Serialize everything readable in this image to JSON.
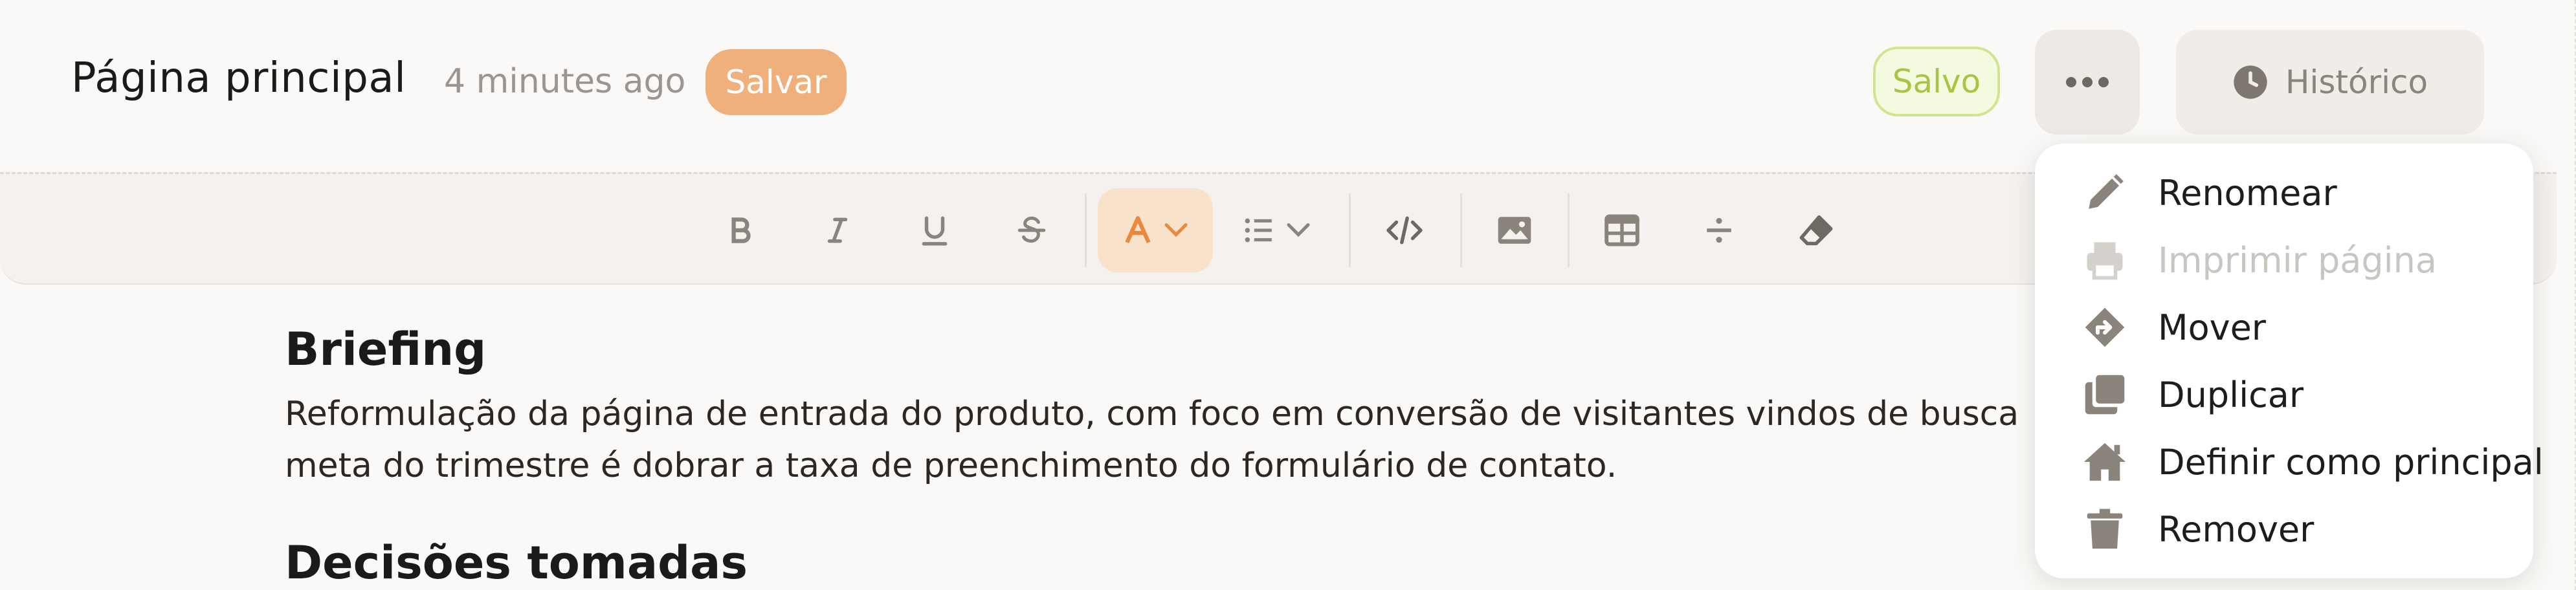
{
  "header": {
    "title": "Página principal",
    "timestamp": "4 minutes ago",
    "save_label": "Salvar",
    "saved_label": "Salvo",
    "more_icon": "more-horizontal-icon",
    "history_label": "Histórico",
    "history_icon": "clock-icon"
  },
  "toolbar": {
    "buttons": [
      {
        "name": "bold",
        "icon": "bold-icon"
      },
      {
        "name": "italic",
        "icon": "italic-icon"
      },
      {
        "name": "underline",
        "icon": "underline-icon"
      },
      {
        "name": "strikethrough",
        "icon": "strikethrough-icon"
      },
      {
        "name": "text-color",
        "icon": "text-color-icon",
        "active": true
      },
      {
        "name": "list",
        "icon": "list-icon"
      },
      {
        "name": "code",
        "icon": "code-icon"
      },
      {
        "name": "image",
        "icon": "image-icon"
      },
      {
        "name": "table",
        "icon": "table-icon"
      },
      {
        "name": "divider",
        "icon": "divide-icon"
      },
      {
        "name": "clear-format",
        "icon": "eraser-icon"
      }
    ],
    "active_color": "#e8893c"
  },
  "document": {
    "heading1": "Briefing",
    "paragraph1_line1": "Reformulação da página de entrada do produto, com foco em conversão de visitantes vindos de busca",
    "paragraph1_line2": "meta do trimestre é dobrar a taxa de preenchimento do formulário de contato.",
    "heading2": "Decisões tomadas"
  },
  "menu": {
    "items": [
      {
        "label": "Renomear",
        "icon": "pencil-icon",
        "disabled": false
      },
      {
        "label": "Imprimir página",
        "icon": "printer-icon",
        "disabled": true
      },
      {
        "label": "Mover",
        "icon": "move-icon",
        "disabled": false
      },
      {
        "label": "Duplicar",
        "icon": "duplicate-icon",
        "disabled": false
      },
      {
        "label": "Definir como principal",
        "icon": "home-icon",
        "disabled": false
      },
      {
        "label": "Remover",
        "icon": "trash-icon",
        "disabled": false
      }
    ]
  },
  "colors": {
    "accent": "#f0b07c",
    "saved_border": "#cfe58f",
    "saved_text": "#a7c443",
    "icon": "#8a847c"
  }
}
